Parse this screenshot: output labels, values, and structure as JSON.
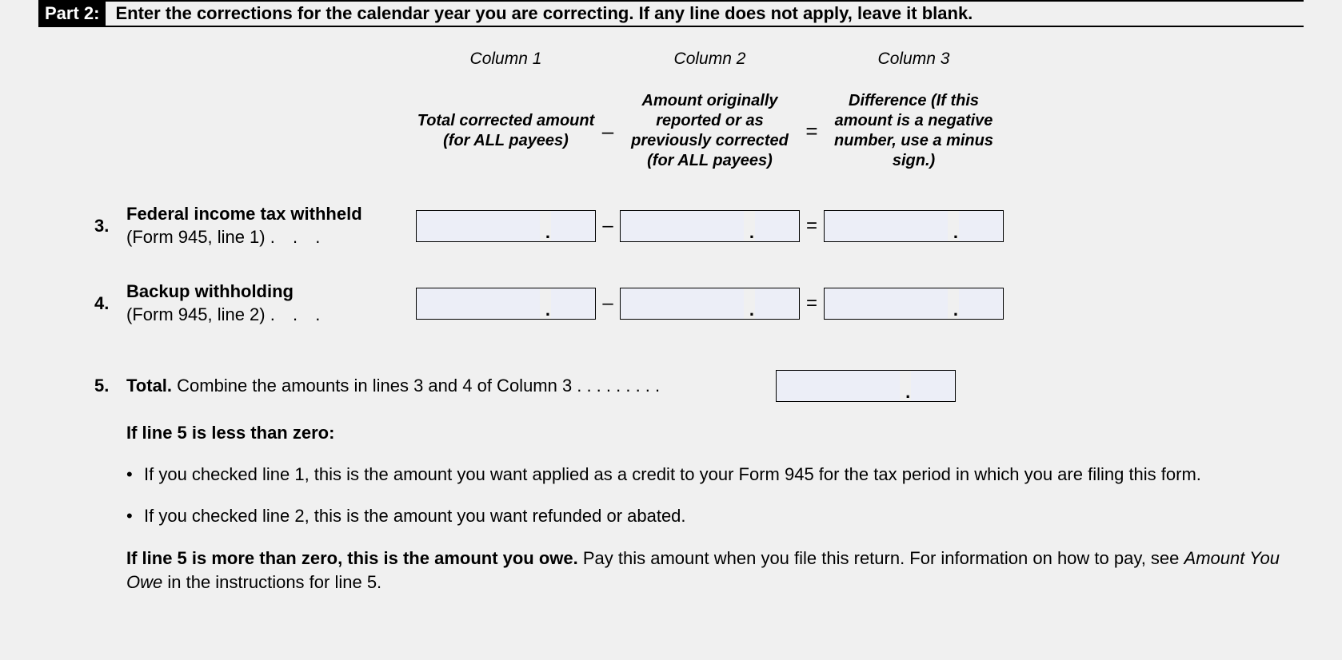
{
  "part": {
    "label": "Part 2:",
    "instruction": "Enter the corrections for the calendar year you are correcting. If any line does not apply, leave it blank."
  },
  "columns": {
    "col1_title": "Column 1",
    "col2_title": "Column 2",
    "col3_title": "Column 3",
    "col1_sub": "Total corrected amount (for ALL payees)",
    "col2_sub": "Amount originally reported or as previously corrected (for ALL payees)",
    "col3_sub": "Difference (If this amount is a negative number,  use a minus sign.)",
    "minus": "–",
    "equals": "="
  },
  "line3": {
    "num": "3.",
    "label_bold": "Federal income tax withheld",
    "label_rest": "(Form 945, line 1)",
    "dots": ".   .   ."
  },
  "line4": {
    "num": "4.",
    "label_bold": "Backup withholding",
    "label_rest": "(Form 945, line 2)",
    "dots": ".   .   ."
  },
  "line5": {
    "num": "5.",
    "label_bold": "Total.",
    "label_rest": " Combine the amounts in lines 3 and 4 of Column 3",
    "dots": " .    .    .    .    .    .    .    .    ."
  },
  "notes": {
    "less_than_zero": "If line 5 is less than zero:",
    "bullet1": "If you checked line 1, this is the amount you want applied as a credit to your Form 945 for the tax period in which you are filing this form.",
    "bullet2": "If you checked line 2, this is the amount you want refunded or abated.",
    "more_than_zero_bold": "If line 5 is more than zero, this is the amount you owe.",
    "more_than_zero_rest_a": " Pay this amount when you file this return. For information on how to pay, see ",
    "more_than_zero_italic": "Amount You Owe",
    "more_than_zero_rest_b": " in the instructions for line 5.",
    "bullet_char": "•"
  }
}
